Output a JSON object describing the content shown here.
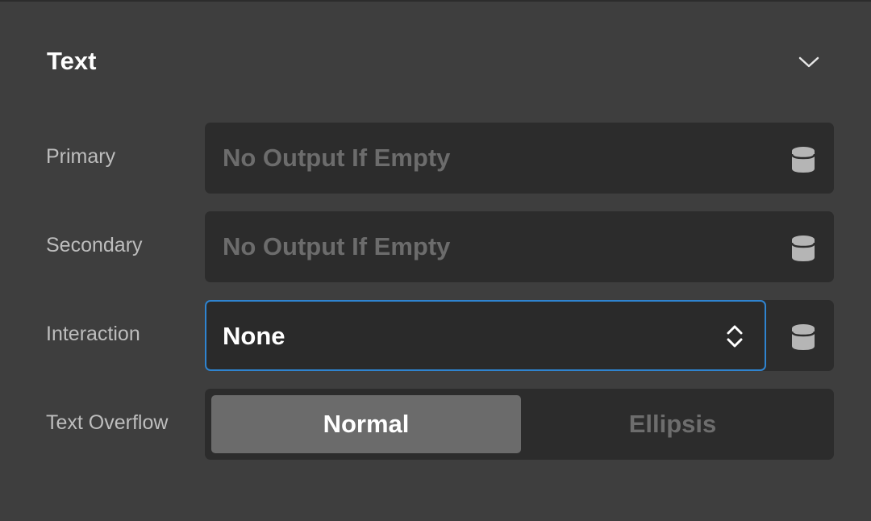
{
  "section": {
    "title": "Text",
    "collapse_icon": "chevron-down-icon"
  },
  "rows": {
    "primary": {
      "label": "Primary",
      "placeholder": "No Output If Empty",
      "icon": "database-icon"
    },
    "secondary": {
      "label": "Secondary",
      "placeholder": "No Output If Empty",
      "icon": "database-icon"
    },
    "interaction": {
      "label": "Interaction",
      "value": "None",
      "icon": "database-icon"
    },
    "text_overflow": {
      "label": "Text Overflow",
      "options": [
        "Normal",
        "Ellipsis"
      ],
      "selected": "Normal"
    }
  },
  "colors": {
    "background": "#3e3e3e",
    "field_bg": "#2c2c2c",
    "focus_border": "#2f84d0",
    "active_segment": "#6b6b6b"
  }
}
